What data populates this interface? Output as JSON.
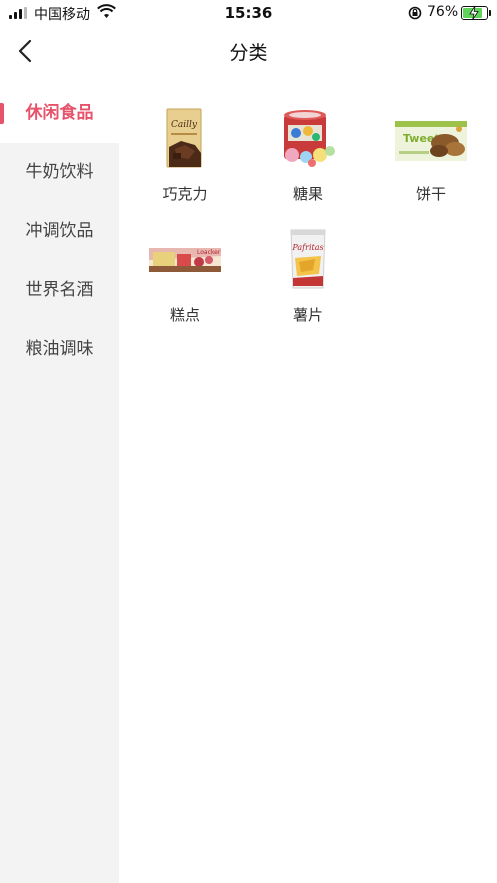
{
  "status_bar": {
    "carrier": "中国移动",
    "time": "15:36",
    "battery_percent": "76%",
    "battery_level": 0.76,
    "icons": [
      "signal-icon",
      "wifi-icon",
      "rotation-lock-icon",
      "battery-charging-icon"
    ]
  },
  "nav": {
    "title": "分类",
    "back_icon": "chevron-left-icon"
  },
  "sidebar": {
    "accent_color": "#e6536a",
    "items": [
      {
        "label": "休闲食品",
        "active": true
      },
      {
        "label": "牛奶饮料",
        "active": false
      },
      {
        "label": "冲调饮品",
        "active": false
      },
      {
        "label": "世界名酒",
        "active": false
      },
      {
        "label": "粮油调味",
        "active": false
      }
    ]
  },
  "categories": [
    {
      "label": "巧克力",
      "image": "chocolate-bar-image"
    },
    {
      "label": "糖果",
      "image": "candy-tin-image"
    },
    {
      "label": "饼干",
      "image": "biscuit-box-image"
    },
    {
      "label": "糕点",
      "image": "wafer-pastry-image"
    },
    {
      "label": "薯片",
      "image": "potato-chips-bag-image"
    }
  ]
}
